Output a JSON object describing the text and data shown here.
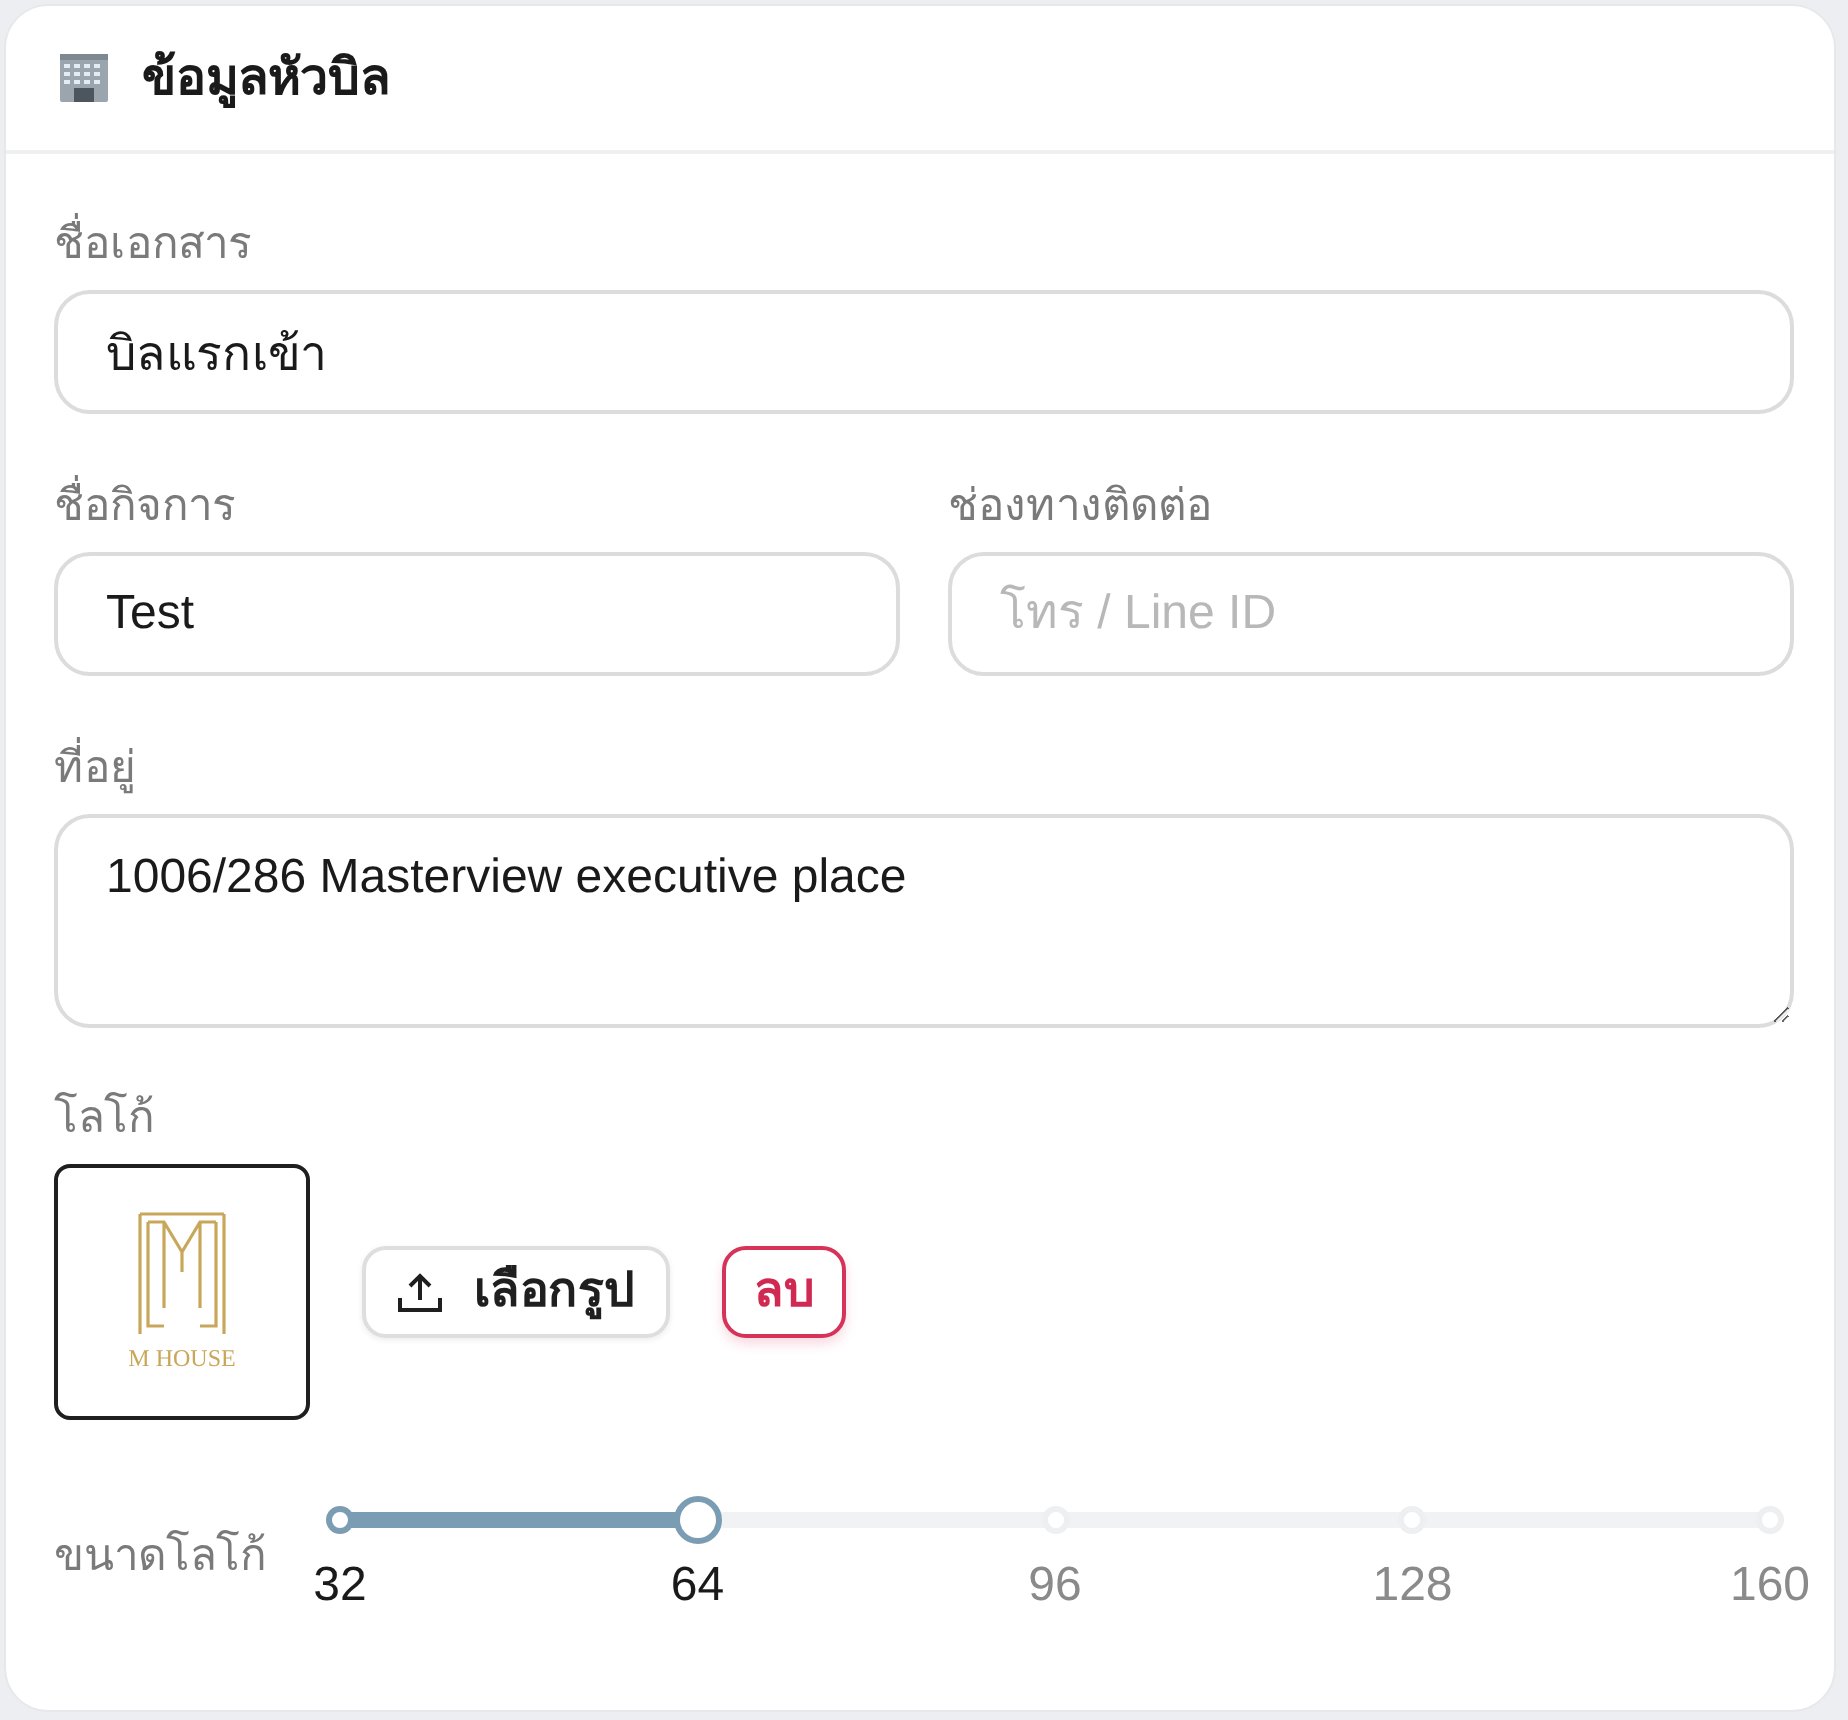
{
  "header": {
    "title": "ข้อมูลหัวบิล"
  },
  "document_name": {
    "label": "ชื่อเอกสาร",
    "value": "บิลแรกเข้า"
  },
  "business_name": {
    "label": "ชื่อกิจการ",
    "value": "Test"
  },
  "contact": {
    "label": "ช่องทางติดต่อ",
    "placeholder": "โทร / Line ID"
  },
  "address": {
    "label": "ที่อยู่",
    "value": "1006/286 Masterview executive place"
  },
  "logo": {
    "label": "โลโก้",
    "wordmark": "M HOUSE",
    "buttons": [
      {
        "kind": "upload",
        "label": "เลือกรูป"
      },
      {
        "kind": "delete",
        "label": "ลบ"
      }
    ]
  },
  "logo_size": {
    "label": "ขนาดโลโก้",
    "level": 0.25,
    "marks": [
      "32",
      "64",
      "96",
      "128",
      "160"
    ]
  }
}
